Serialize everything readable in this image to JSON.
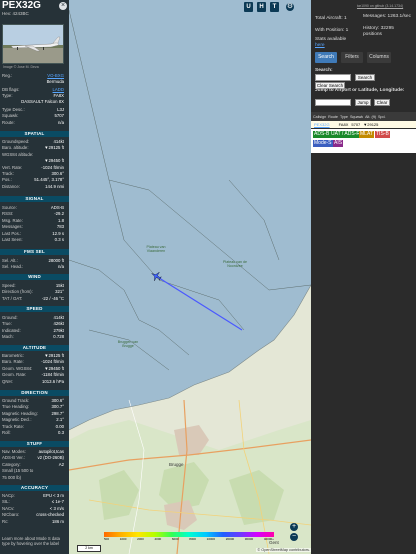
{
  "info": {
    "callsign": "PEX32G",
    "hex_line": "Hex:   4243BC",
    "close": "×",
    "photo_credit": "Image © Jose M. Deza",
    "reg": {
      "k": "Reg.:",
      "v": "VO-BXG"
    },
    "country": {
      "k": "",
      "v": "Bermuda"
    },
    "db_flags": {
      "k": "DB flags:",
      "v": "LADD"
    },
    "type": {
      "k": "Type:",
      "v": "FA8X"
    },
    "type_name": "DASSAULT Falcon 8X",
    "type_desc": {
      "k": "Type Desc.:",
      "v": "L3J"
    },
    "squawk": {
      "k": "Squawk:",
      "v": "5707"
    },
    "route": {
      "k": "Route:",
      "v": "n/a"
    },
    "sections": {
      "spatial": "SPATIAL",
      "signal": "SIGNAL",
      "fms": "FMS SEL",
      "wind": "WIND",
      "speed": "SPEED",
      "altitude": "ALTITUDE",
      "direction": "DIRECTION",
      "stuff": "STUFF",
      "accuracy": "ACCURACY"
    },
    "spatial": [
      {
        "k": "Groundspeed:",
        "v": "414kt"
      },
      {
        "k": "Baro. altitude:",
        "v": "▼29125 ft"
      },
      {
        "k": "WGS84 altitude:",
        "v": ""
      },
      {
        "k": "",
        "v": "▼29450 ft"
      },
      {
        "k": "Vert. Rate:",
        "v": "-1024 ft/min"
      },
      {
        "k": "Track:",
        "v": "300.6°"
      },
      {
        "k": "Pos.:",
        "v": "51.445°, 3.178°"
      },
      {
        "k": "Distance:",
        "v": "144.9 nmi"
      }
    ],
    "signal": [
      {
        "k": "Source:",
        "v": "ADS-B"
      },
      {
        "k": "RSSI:",
        "v": "-29.2"
      },
      {
        "k": "Msg. Rate:",
        "v": "1.8"
      },
      {
        "k": "Messages:",
        "v": "783"
      },
      {
        "k": "Last Pos.:",
        "v": "12.9 s"
      },
      {
        "k": "Last Seen:",
        "v": "0.3 s"
      }
    ],
    "fms": [
      {
        "k": "Sel. Alt.:",
        "v": "28000 ft"
      },
      {
        "k": "Sel. Head.:",
        "v": "n/a"
      }
    ],
    "wind": [
      {
        "k": "Speed:",
        "v": "15kt"
      },
      {
        "k": "Direction (from):",
        "v": "321°"
      },
      {
        "k": "TAT / OAT:",
        "v": "-22 / -46 °C"
      }
    ],
    "speed": [
      {
        "k": "Ground:",
        "v": "414kt"
      },
      {
        "k": "True:",
        "v": "426kt"
      },
      {
        "k": "Indicated:",
        "v": "279kt"
      },
      {
        "k": "Mach:",
        "v": "0.728"
      }
    ],
    "altitude": [
      {
        "k": "Barometric:",
        "v": "▼29125 ft"
      },
      {
        "k": "Baro. Rate:",
        "v": "-1024 ft/min"
      },
      {
        "k": "Geom. WGS84:",
        "v": "▼29450 ft"
      },
      {
        "k": "Geom. Rate:",
        "v": "-1184 ft/min"
      },
      {
        "k": "QNH:",
        "v": "1013.6 hPa"
      }
    ],
    "direction": [
      {
        "k": "Ground Track:",
        "v": "300.6°"
      },
      {
        "k": "True Heading:",
        "v": "300.7°"
      },
      {
        "k": "Magnetic Heading:",
        "v": "298.7°"
      },
      {
        "k": "Magnetic Decl.:",
        "v": "2.1°"
      },
      {
        "k": "Track Rate:",
        "v": "0.00"
      },
      {
        "k": "Roll:",
        "v": "0.3"
      }
    ],
    "stuff": [
      {
        "k": "Nav. Modes:",
        "v": "autopilot,tcas"
      },
      {
        "k": "ADS-B Ver.:",
        "v": "v2 (DO-260B)"
      },
      {
        "k": "Category:",
        "v": "A2"
      },
      {
        "k": "Small (15 500 to",
        "v": ""
      },
      {
        "k": "75 000 lb)",
        "v": ""
      }
    ],
    "accuracy": [
      {
        "k": "NACp:",
        "v": "EPU < 3 m"
      },
      {
        "k": "SIL:",
        "v": "≤ 1e-7"
      },
      {
        "k": "NACv:",
        "v": "< 3 m/s"
      },
      {
        "k": "NICbaro:",
        "v": "cross-checked"
      },
      {
        "k": "Rc:",
        "v": "186 m"
      }
    ],
    "footer": "Learn more about Mode S data type by hovering over the label"
  },
  "map": {
    "buttons": [
      "U",
      "H",
      "T"
    ],
    "side_buttons": [
      "O",
      "K",
      "L",
      "V",
      "M",
      "P",
      "I",
      "R"
    ],
    "labels": {
      "zone1": "Plateau van Vlaanderen",
      "zone2": "Plateau van de Noordzee",
      "zone3": "Bruggen van Brugge",
      "city_brugge": "Brugge",
      "city_gent": "Gent"
    },
    "scale": "2 km",
    "legend_ticks": [
      "500",
      "1000",
      "2000",
      "4000",
      "6000",
      "8000",
      "10000",
      "20000",
      "30000",
      "40000+"
    ],
    "zoom_in": "+",
    "zoom_out": "−",
    "attribution": "© OpenStreetMap contributors."
  },
  "sidebar": {
    "top_link": "tar1090 on github (3.14.1734)",
    "total_aircraft": "Total Aircraft: 1",
    "with_position": "With Position: 1",
    "messages": "Messages: 1263.1/sec",
    "history": "History: 32295 positions",
    "stats_available": "Stats available",
    "stats_link": "here",
    "tabs": [
      "Search",
      "Filters",
      "Columns"
    ],
    "search_label": "Search:",
    "search_button": "Search",
    "clear_button": "Clear Search",
    "jump_label": "Jump to Airport or Latitude, Longitude:",
    "jump_button": "Jump",
    "clear_button2": "Clear",
    "columns": [
      "Callsign",
      "Route",
      "Type",
      "Squawk",
      "Alt. (ft)",
      "Spd."
    ],
    "row": {
      "callsign": "PEX32G",
      "type": "FA8X",
      "squawk": "5707",
      "alt": "▼29125"
    },
    "sources": [
      {
        "label": "ADS-B",
        "color": "#1a8a2a"
      },
      {
        "label": "UAT / ADS-R",
        "color": "#1a8a2a"
      },
      {
        "label": "MLAT",
        "color": "#c28a00"
      },
      {
        "label": "TIS-B",
        "color": "#d14a4a"
      },
      {
        "label": "Mode-S",
        "color": "#3b5fc0"
      },
      {
        "label": "AIS",
        "color": "#8a2a8a"
      }
    ]
  }
}
